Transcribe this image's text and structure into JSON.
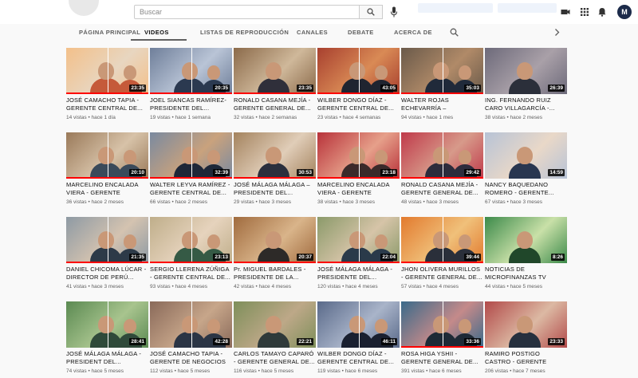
{
  "search": {
    "placeholder": "Buscar"
  },
  "account": {
    "initial": "M"
  },
  "tabs": [
    {
      "label": "PÁGINA PRINCIPAL"
    },
    {
      "label": "VIDEOS"
    },
    {
      "label": "LISTAS DE REPRODUCCIÓN"
    },
    {
      "label": "CANALES"
    },
    {
      "label": "DEBATE"
    },
    {
      "label": "ACERCA DE"
    }
  ],
  "videos": [
    {
      "title": "JOSÉ CAMACHO TAPIA - GERENTE CENTRAL DE...",
      "meta": "14 vistas • hace 1 día",
      "duration": "23:35",
      "progress": 1.0
    },
    {
      "title": "JOEL SIANCAS RAMÍREZ- PRESIDENTE DEL...",
      "meta": "19 vistas • hace 1 semana",
      "duration": "20:35",
      "progress": 1.0
    },
    {
      "title": "RONALD CASANA MEJÍA - GERENTE GENERAL DE...",
      "meta": "32 vistas • hace 2 semanas",
      "duration": "23:35",
      "progress": 1.0
    },
    {
      "title": "WILBER DONGO DÍAZ - GERENTE CENTRAL DE...",
      "meta": "23 vistas • hace 4 semanas",
      "duration": "43:05",
      "progress": 1.0
    },
    {
      "title": "WALTER ROJAS ECHEVARRÍA – GERENTE...",
      "meta": "94 vistas • hace 1 mes",
      "duration": "35:03",
      "progress": 1.0
    },
    {
      "title": "ING. FERNANDO RUIZ CARO VILLAGARCÍA -...",
      "meta": "38 vistas • hace 2 meses",
      "duration": "26:39",
      "progress": 0
    },
    {
      "title": "MARCELINO ENCALADA VIERA - GERENTE CENTRA...",
      "meta": "36 vistas • hace 2 meses",
      "duration": "20:10",
      "progress": 1.0
    },
    {
      "title": "WALTER LEYVA RAMÍREZ - GERENTE CENTRAL DE...",
      "meta": "66 vistas • hace 2 meses",
      "duration": "32:39",
      "progress": 1.0
    },
    {
      "title": "JOSÉ MÁLAGA MÁLAGA – PRESIDENTE DEL...",
      "meta": "29 vistas • hace 3 meses",
      "duration": "30:53",
      "progress": 1.0
    },
    {
      "title": "MARCELINO ENCALADA VIERA - GERENTE CENTRA...",
      "meta": "38 vistas • hace 3 meses",
      "duration": "23:18",
      "progress": 1.0
    },
    {
      "title": "RONALD CASANA MEJÍA - GERENTE GENERAL DE...",
      "meta": "48 vistas • hace 3 meses",
      "duration": "29:42",
      "progress": 1.0
    },
    {
      "title": "NANCY BAQUEDANO ROMERO - GERENTE...",
      "meta": "67 vistas • hace 3 meses",
      "duration": "14:59",
      "progress": 0
    },
    {
      "title": "DANIEL CHICOMA LÚCAR - DIRECTOR DE PERÚ...",
      "meta": "41 vistas • hace 3 meses",
      "duration": "21:35",
      "progress": 1.0
    },
    {
      "title": "SERGIO LLERENA ZÚÑIGA - GERENTE CENTRAL DE...",
      "meta": "93 vistas • hace 4 meses",
      "duration": "23:13",
      "progress": 1.0
    },
    {
      "title": "Pr. MIGUEL BARDALES - PRESIDENTE DE LA...",
      "meta": "42 vistas • hace 4 meses",
      "duration": "20:37",
      "progress": 1.0
    },
    {
      "title": "JOSÉ MÁLAGA MÁLAGA - PRESIDENTE DEL...",
      "meta": "120 vistas • hace 4 meses",
      "duration": "22:04",
      "progress": 1.0
    },
    {
      "title": "JHON OLIVERA MURILLOS - GERENTE GENERAL DE...",
      "meta": "57 vistas • hace 4 meses",
      "duration": "39:44",
      "progress": 1.0
    },
    {
      "title": "NOTICIAS DE MICROFINANZAS TV",
      "meta": "44 vistas • hace 5 meses",
      "duration": "8:26",
      "progress": 0
    },
    {
      "title": "JOSÉ MÁLAGA MÁLAGA - PRESIDENT DEL...",
      "meta": "74 vistas • hace 5 meses",
      "duration": "28:41",
      "progress": 0
    },
    {
      "title": "JOSÉ CAMACHO TAPIA - GERENTE DE NEGOCIOS D...",
      "meta": "112 vistas • hace 5 meses",
      "duration": "42:28",
      "progress": 0
    },
    {
      "title": "CARLOS TAMAYO CAPARÓ - GERENTE GENERAL DE...",
      "meta": "116 vistas • hace 5 meses",
      "duration": "22:21",
      "progress": 0
    },
    {
      "title": "WILBER DONGO DÍAZ - GERENTE CENTRAL DE...",
      "meta": "119 vistas • hace 6 meses",
      "duration": "46:11",
      "progress": 0
    },
    {
      "title": "ROSA HIGA YSHII - GERENTE GENERAL DE...",
      "meta": "391 vistas • hace 6 meses",
      "duration": "33:36",
      "progress": 1.0
    },
    {
      "title": "RAMIRO POSTIGO CASTRO - GERENTE GENERAL DE...",
      "meta": "206 vistas • hace 7 meses",
      "duration": "23:33",
      "progress": 0
    }
  ]
}
